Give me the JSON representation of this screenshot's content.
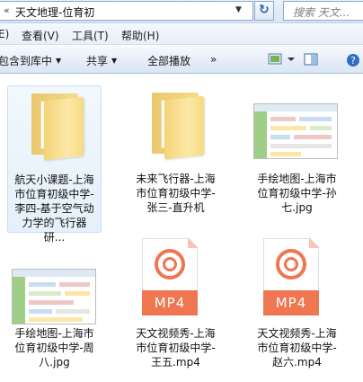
{
  "window": {
    "breadcrumb_chevron": "«",
    "address": "天文地理-位育初",
    "search_placeholder": "搜索 天文..."
  },
  "menu": {
    "items": [
      "E)",
      "查看(V)",
      "工具(T)",
      "帮助(H)"
    ]
  },
  "commands": {
    "include_library": "包含到库中",
    "share": "共享",
    "play_all": "全部播放",
    "more": "»"
  },
  "files": [
    {
      "name": "航天小课题-上海市位育初级中学-李四-基于空气动力学的飞行器研...",
      "type": "folder",
      "selected": true
    },
    {
      "name": "未来飞行器-上海市位育初级中学-张三-直升机",
      "type": "folder",
      "selected": false
    },
    {
      "name": "手绘地图-上海市位育初级中学-孙七.jpg",
      "type": "image",
      "selected": false
    },
    {
      "name": "手绘地图-上海市位育初级中学-周八.jpg",
      "type": "image",
      "selected": false
    },
    {
      "name": "天文视频秀-上海市位育初级中学-王五.mp4",
      "type": "video",
      "selected": false
    },
    {
      "name": "天文视频秀-上海市位育初级中学-赵六.mp4",
      "type": "video",
      "selected": false
    }
  ],
  "mp4_badge": "MP4",
  "colors": {
    "mp4_accent": "#ef7650",
    "folder": "#f3d477",
    "selection": "#e4f0fb"
  }
}
